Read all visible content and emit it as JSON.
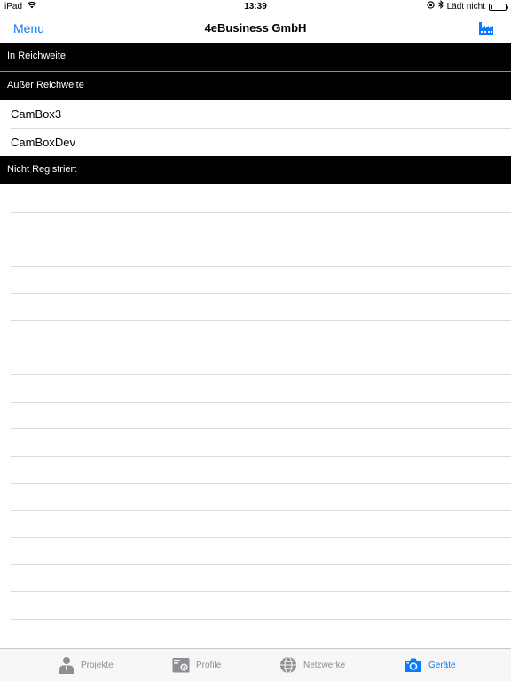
{
  "status_bar": {
    "device": "iPad",
    "time": "13:39",
    "charging_text": "Lädt nicht",
    "battery_level": 0.15
  },
  "nav": {
    "menu_label": "Menu",
    "title": "4eBusiness GmbH",
    "right_icon": "factory-icon"
  },
  "sections": {
    "in_range": "In Reichweite",
    "out_of_range": "Außer Reichweite",
    "not_registered": "Nicht Registriert"
  },
  "devices_out_of_range": [
    "CamBox3",
    "CamBoxDev"
  ],
  "tabs": [
    {
      "label": "Projekte",
      "icon": "person-icon",
      "active": false
    },
    {
      "label": "Profile",
      "icon": "profile-folder-icon",
      "active": false
    },
    {
      "label": "Netzwerke",
      "icon": "globe-icon",
      "active": false
    },
    {
      "label": "Geräte",
      "icon": "camera-icon",
      "active": true
    }
  ],
  "colors": {
    "accent": "#0a7aff",
    "section_header_bg": "#000000",
    "inactive_tab": "#8e8e93"
  }
}
